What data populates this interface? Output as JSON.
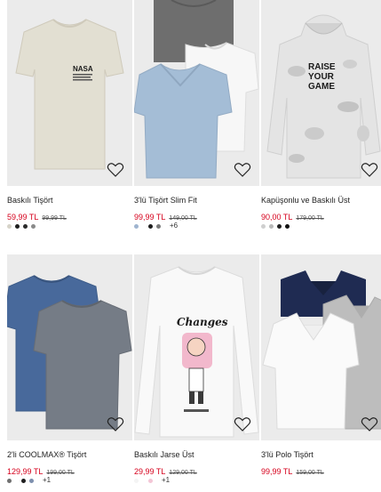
{
  "products": [
    {
      "name": "Baskılı Tişört",
      "price": "59,99 TL",
      "old_price": "99,99 TL",
      "swatches": [
        "#d6d3c8",
        "#1f1f1f",
        "#2b2b2b",
        "#8a8a8a"
      ],
      "more": "",
      "image": "beige-tshirt-nasa-print"
    },
    {
      "name": "3'lü Tişört Slim Fit",
      "price": "99,99 TL",
      "old_price": "149,00 TL",
      "swatches": [
        "#9fb4cf",
        "#1e1e1e",
        "#7a7a7a"
      ],
      "more": "+6",
      "image": "three-pack-tshirts"
    },
    {
      "name": "Kapüşonlu ve Baskılı Üst",
      "price": "90,00 TL",
      "old_price": "179,00 TL",
      "swatches": [
        "#cfcfcf",
        "#b9b9b9",
        "#1f1f1f",
        "#111111"
      ],
      "more": "",
      "image": "camo-hoodie-raise-your-game"
    },
    {
      "name": "2'li COOLMAX® Tişört",
      "price": "129,99 TL",
      "old_price": "199,00 TL",
      "swatches": [
        "#6f6f6f",
        "#1e1e1e",
        "#7d8fae"
      ],
      "more": "+1",
      "image": "two-pack-coolmax-tshirts"
    },
    {
      "name": "Baskılı Jarse Üst",
      "price": "29,99 TL",
      "old_price": "129,00 TL",
      "swatches": [
        "#f4f4f4",
        "#f3c6d6"
      ],
      "more": "+1",
      "image": "long-sleeve-changes-print"
    },
    {
      "name": "3'lü Polo Tişört",
      "price": "99,99 TL",
      "old_price": "159,00 TL",
      "swatches": [],
      "more": "",
      "image": "three-pack-polo-shirts"
    }
  ],
  "print_texts": {
    "nasa": "NASA",
    "hoodie_line1": "RAISE",
    "hoodie_line2": "YOUR",
    "hoodie_line3": "GAME",
    "changes": "Changes"
  },
  "colors": {
    "sale_price": "#d6001c",
    "photo_background": "#ebebeb"
  },
  "icons": {
    "favorite": "heart-outline-icon"
  }
}
